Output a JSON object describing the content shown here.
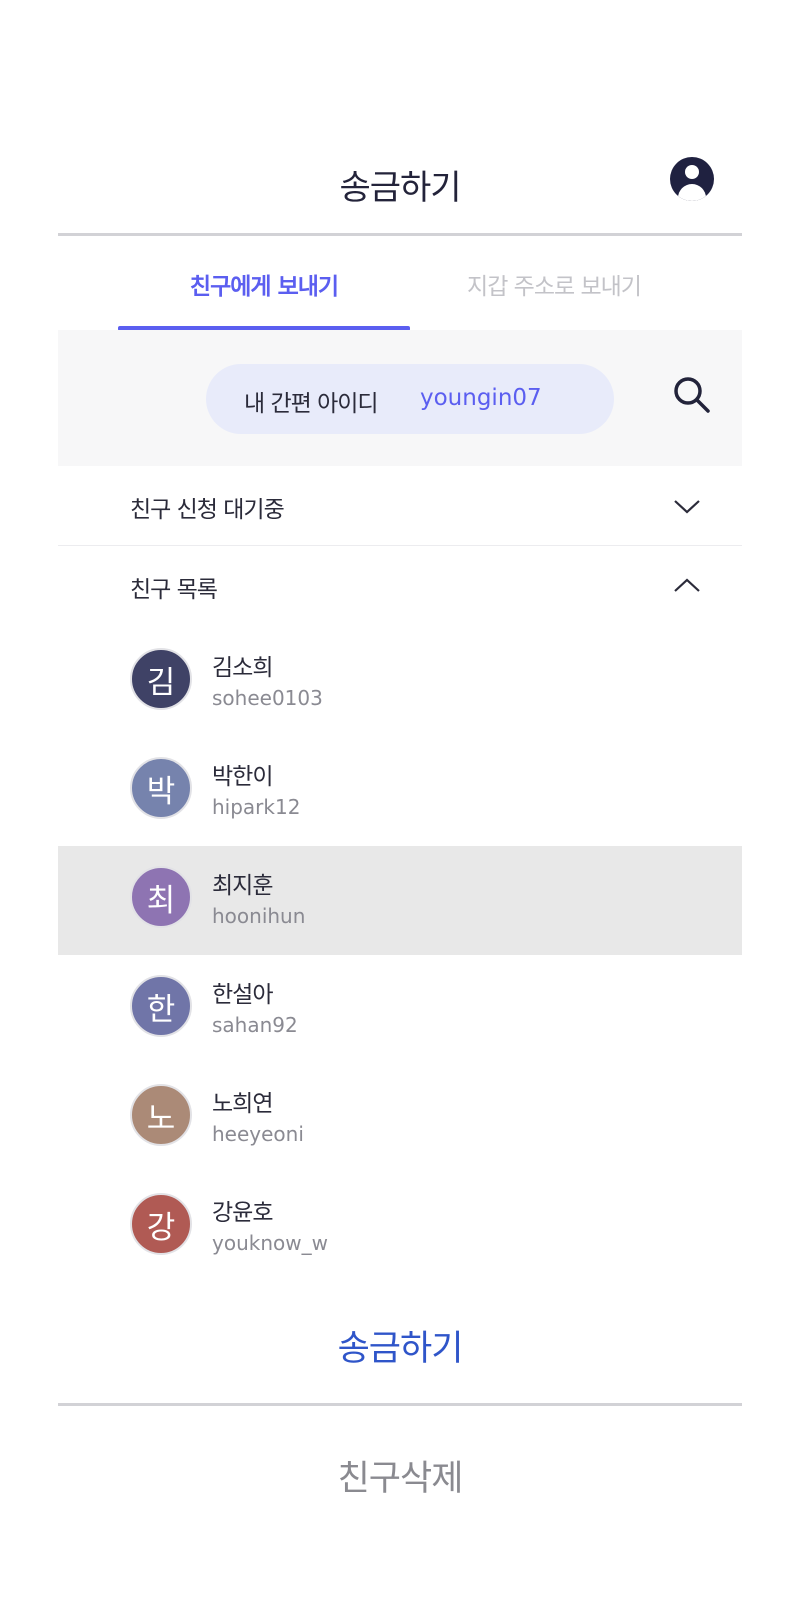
{
  "header": {
    "title": "송금하기",
    "account_icon": "account-circle-icon"
  },
  "tabs": [
    {
      "label": "친구에게 보내기",
      "active": true
    },
    {
      "label": "지갑 주소로 보내기",
      "active": false
    }
  ],
  "colors": {
    "accent": "#5b5ef0",
    "send": "#2f55c9",
    "selected_row": "#e8e8e8",
    "pill": "#e8ebfa"
  },
  "easy_id": {
    "label": "내 간편 아이디",
    "value": "youngin07"
  },
  "search": {
    "icon": "search-icon"
  },
  "sections": {
    "pending": {
      "label": "친구 신청 대기중",
      "expanded": false
    },
    "friends": {
      "label": "친구 목록",
      "expanded": true
    }
  },
  "friends": [
    {
      "initial": "김",
      "name": "김소희",
      "id": "sohee0103",
      "color": "#3f4266",
      "selected": false
    },
    {
      "initial": "박",
      "name": "박한이",
      "id": "hipark12",
      "color": "#7683ad",
      "selected": false
    },
    {
      "initial": "최",
      "name": "최지훈",
      "id": "hoonihun",
      "color": "#8e74b2",
      "selected": true
    },
    {
      "initial": "한",
      "name": "한설아",
      "id": "sahan92",
      "color": "#7075a8",
      "selected": false
    },
    {
      "initial": "노",
      "name": "노희연",
      "id": "heeyeoni",
      "color": "#ab8a77",
      "selected": false
    },
    {
      "initial": "강",
      "name": "강윤호",
      "id": "youknow_w",
      "color": "#b05a54",
      "selected": false
    }
  ],
  "actions": {
    "send": "송금하기",
    "delete": "친구삭제"
  }
}
